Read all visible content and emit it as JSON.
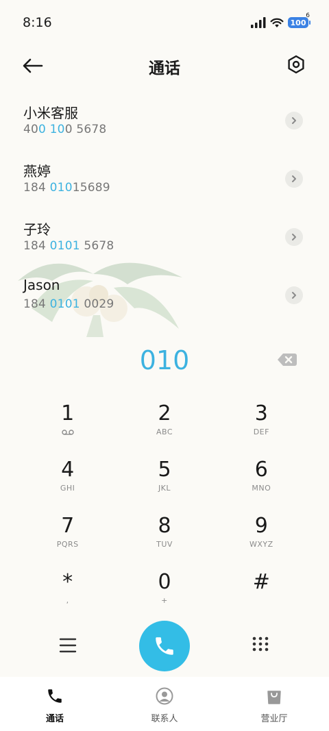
{
  "status_bar": {
    "time": "8:16",
    "battery_level": "100",
    "wifi_badge": "6",
    "icons": [
      "signal-icon",
      "wifi-icon",
      "battery-icon"
    ]
  },
  "header": {
    "title": "通话",
    "back_icon": "back-arrow-icon",
    "settings_icon": "settings-icon"
  },
  "contacts": [
    {
      "name": "小米客服",
      "number_parts": [
        [
          "40",
          false
        ],
        [
          "0 10",
          true
        ],
        [
          "0 5678",
          false
        ]
      ]
    },
    {
      "name": "燕婷",
      "number_parts": [
        [
          "184 ",
          false
        ],
        [
          "010",
          true
        ],
        [
          "15689",
          false
        ]
      ]
    },
    {
      "name": "子玲",
      "number_parts": [
        [
          "184 ",
          false
        ],
        [
          "0101",
          true
        ],
        [
          " 5678",
          false
        ]
      ]
    },
    {
      "name": "Jason",
      "number_parts": [
        [
          "184 ",
          false
        ],
        [
          "0101",
          true
        ],
        [
          " 0029",
          false
        ]
      ]
    }
  ],
  "dial": {
    "digits": "010",
    "highlight_color": "#3CB2E0"
  },
  "keypad": [
    {
      "digit": "1",
      "sub": ""
    },
    {
      "digit": "2",
      "sub": "ABC"
    },
    {
      "digit": "3",
      "sub": "DEF"
    },
    {
      "digit": "4",
      "sub": "GHI"
    },
    {
      "digit": "5",
      "sub": "JKL"
    },
    {
      "digit": "6",
      "sub": "MNO"
    },
    {
      "digit": "7",
      "sub": "PQRS"
    },
    {
      "digit": "8",
      "sub": "TUV"
    },
    {
      "digit": "9",
      "sub": "WXYZ"
    },
    {
      "digit": "*",
      "sub": ","
    },
    {
      "digit": "0",
      "sub": "+"
    },
    {
      "digit": "#",
      "sub": ""
    }
  ],
  "actions": {
    "menu_icon": "menu-icon",
    "call_icon": "phone-icon",
    "keypad_icon": "dialpad-icon",
    "call_color": "#33BDE6"
  },
  "bottom_nav": [
    {
      "label": "通话",
      "icon": "phone-icon",
      "active": true
    },
    {
      "label": "联系人",
      "icon": "contacts-icon",
      "active": false
    },
    {
      "label": "营业厅",
      "icon": "store-bag-icon",
      "active": false
    }
  ]
}
